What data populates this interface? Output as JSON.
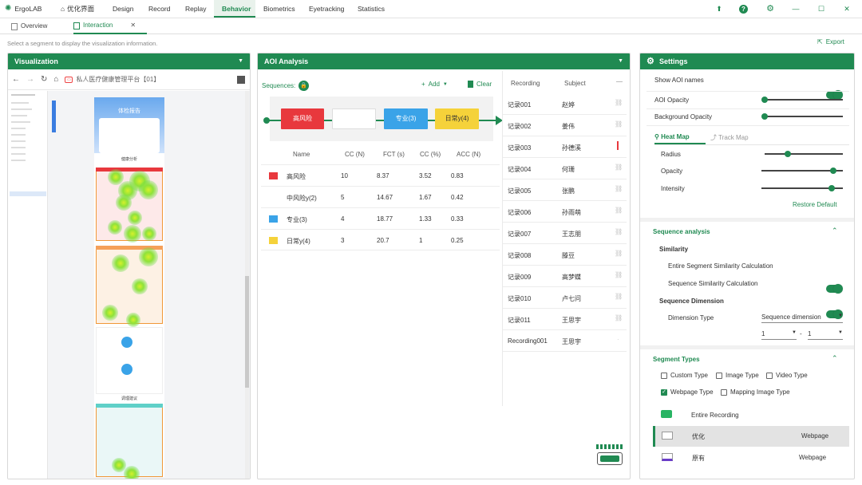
{
  "app": {
    "name": "ErgoLAB",
    "home_label": "优化界面"
  },
  "menu": [
    "Design",
    "Record",
    "Replay",
    "Behavior",
    "Biometrics",
    "Eyetracking",
    "Statistics"
  ],
  "menu_active": "Behavior",
  "tabs": [
    {
      "label": "Overview"
    },
    {
      "label": "Interaction"
    }
  ],
  "hint": "Select a segment to display the visualization information.",
  "export_label": "Export",
  "viz": {
    "title": "Visualization",
    "url": "私人医疗健康管理平台【01】",
    "page_heading": "体检报告",
    "section1": "健康分析",
    "section2": "调理建议"
  },
  "aoi": {
    "title": "AOI Analysis",
    "sequences_label": "Sequences:",
    "add_label": "Add",
    "clear_label": "Clear",
    "sequence": [
      {
        "label": "高风险",
        "color": "#e8383d"
      },
      {
        "label": "",
        "color": "#ffffff"
      },
      {
        "label": "专业(3)",
        "color": "#3aa3e8"
      },
      {
        "label": "日常y(4)",
        "color": "#f5d23a"
      }
    ],
    "columns": [
      "Name",
      "CC (N)",
      "FCT (s)",
      "CC (%)",
      "ACC (N)"
    ],
    "rows": [
      {
        "name": "高风险",
        "color": "#e8383d",
        "cc_n": "10",
        "fct": "8.37",
        "cc_pct": "3.52",
        "acc": "0.83"
      },
      {
        "name": "中风险y(2)",
        "color": "",
        "cc_n": "5",
        "fct": "14.67",
        "cc_pct": "1.67",
        "acc": "0.42"
      },
      {
        "name": "专业(3)",
        "color": "#3aa3e8",
        "cc_n": "4",
        "fct": "18.77",
        "cc_pct": "1.33",
        "acc": "0.33"
      },
      {
        "name": "日常y(4)",
        "color": "#f5d23a",
        "cc_n": "3",
        "fct": "20.7",
        "cc_pct": "1",
        "acc": "0.25"
      }
    ]
  },
  "recordings": {
    "columns": [
      "Recording",
      "Subject"
    ],
    "rows": [
      {
        "rec": "记录001",
        "subject": "赵婷"
      },
      {
        "rec": "记录002",
        "subject": "姜伟"
      },
      {
        "rec": "记录003",
        "subject": "孙德溪"
      },
      {
        "rec": "记录004",
        "subject": "何珊"
      },
      {
        "rec": "记录005",
        "subject": "张鹏"
      },
      {
        "rec": "记录006",
        "subject": "孙雨萌"
      },
      {
        "rec": "记录007",
        "subject": "王志朋"
      },
      {
        "rec": "记录008",
        "subject": "滕豆"
      },
      {
        "rec": "记录009",
        "subject": "高梦蝶"
      },
      {
        "rec": "记录010",
        "subject": "卢七问"
      },
      {
        "rec": "记录011",
        "subject": "王思宇"
      },
      {
        "rec": "Recording001",
        "subject": "王思宇"
      }
    ]
  },
  "settings": {
    "title": "Settings",
    "show_aoi_names": "Show AOI names",
    "aoi_opacity": "AOI Opacity",
    "bg_opacity": "Background Opacity",
    "tab_heat": "Heat Map",
    "tab_track": "Track Map",
    "radius": "Radius",
    "opacity": "Opacity",
    "intensity": "Intensity",
    "restore": "Restore Default",
    "seq_analysis": "Sequence analysis",
    "similarity": "Similarity",
    "entire_similarity": "Entire Segment Similarity Calculation",
    "seq_similarity": "Sequence Similarity Calculation",
    "seq_dimension": "Sequence Dimension",
    "dimension_type": "Dimension Type",
    "dimension_value": "Sequence dimension",
    "dim_from": "1",
    "dim_dash": "-",
    "dim_to": "1",
    "segment_types": "Segment Types",
    "types": [
      "Custom Type",
      "Image Type",
      "Video Type",
      "Webpage Type",
      "Mapping Image Type"
    ],
    "segments": [
      {
        "name": "Entire Recording",
        "type": ""
      },
      {
        "name": "优化",
        "type": "Webpage"
      },
      {
        "name": "原有",
        "type": "Webpage"
      }
    ]
  },
  "levels": {
    "aoi_opacity": 0.0,
    "bg_opacity": 0.0,
    "radius": 0.3,
    "opacity": 0.88,
    "intensity": 0.86
  },
  "colors": {
    "accent": "#208a52",
    "red": "#e8383d",
    "blue": "#3aa3e8",
    "yellow": "#f5d23a"
  }
}
